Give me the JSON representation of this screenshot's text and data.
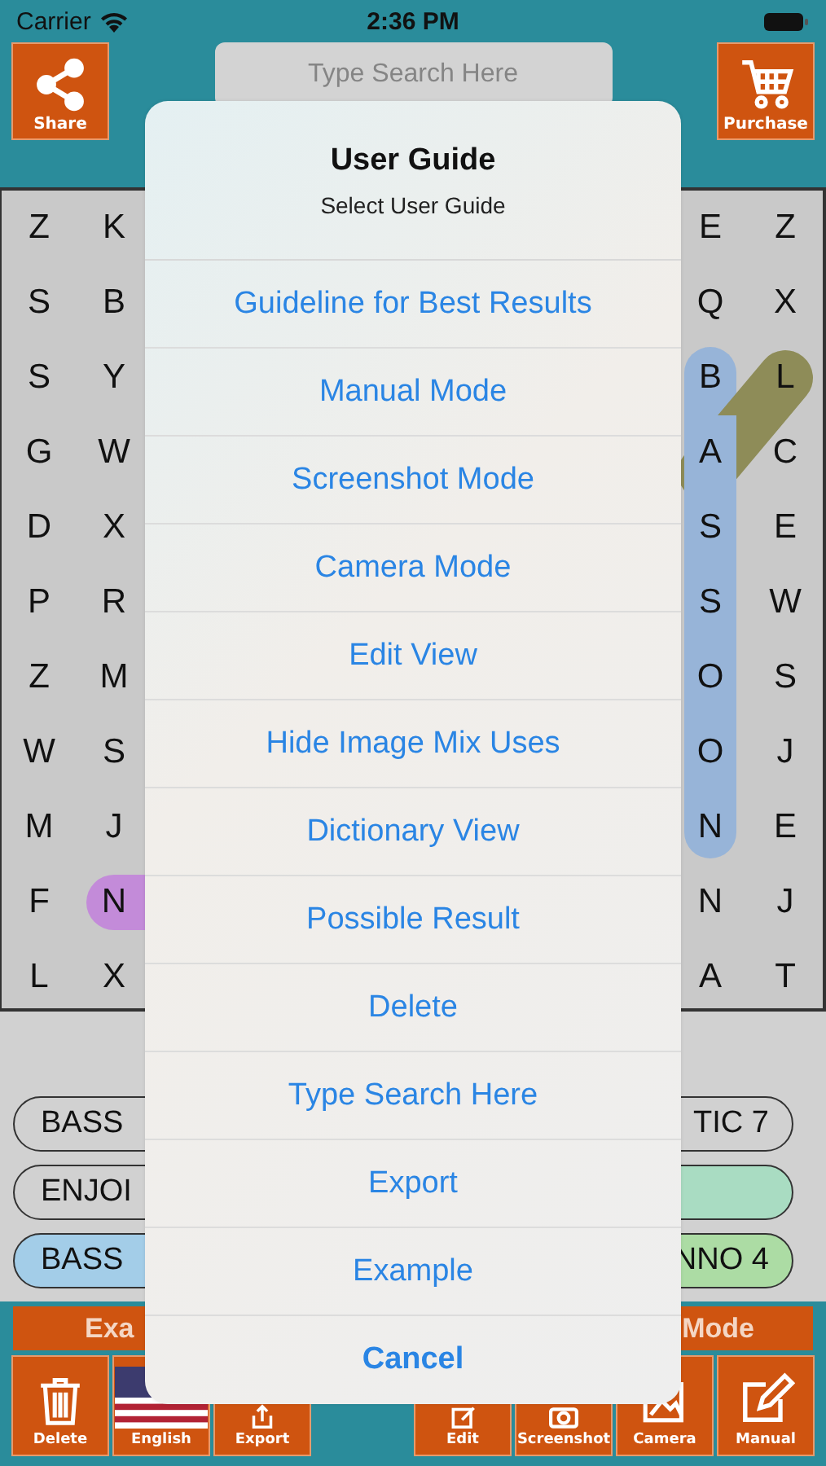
{
  "status_bar": {
    "carrier": "Carrier",
    "time": "2:36 PM"
  },
  "toolbar": {
    "share": {
      "label": "Share",
      "kind": "share"
    },
    "search": {
      "placeholder": "Type Search Here"
    },
    "purchase": {
      "label": "Purchase",
      "kind": "cart"
    }
  },
  "grid": {
    "rows": [
      {
        "left": [
          {
            "letter": "Z"
          },
          {
            "letter": "K"
          }
        ],
        "right": [
          {
            "letter": "E"
          },
          {
            "letter": "Z"
          }
        ]
      },
      {
        "left": [
          {
            "letter": "S"
          },
          {
            "letter": "B"
          }
        ],
        "right": [
          {
            "letter": "Q"
          },
          {
            "letter": "X"
          }
        ]
      },
      {
        "left": [
          {
            "letter": "S"
          },
          {
            "letter": "Y"
          }
        ],
        "right": [
          {
            "letter": "B",
            "mark": {
              "color": "#97b4d8",
              "kind": "vertical"
            }
          },
          {
            "letter": "L",
            "mark": {
              "color": "#8e8c58",
              "kind": "diagonal"
            }
          }
        ]
      },
      {
        "left": [
          {
            "letter": "G"
          },
          {
            "letter": "W"
          }
        ],
        "right": [
          {
            "letter": "A",
            "mark": {
              "color": "#97b4d8",
              "kind": "vertical"
            }
          },
          {
            "letter": "C"
          }
        ]
      },
      {
        "left": [
          {
            "letter": "D"
          },
          {
            "letter": "X"
          }
        ],
        "right": [
          {
            "letter": "S",
            "mark": {
              "color": "#97b4d8",
              "kind": "vertical"
            }
          },
          {
            "letter": "E"
          }
        ]
      },
      {
        "left": [
          {
            "letter": "P"
          },
          {
            "letter": "R"
          }
        ],
        "right": [
          {
            "letter": "S",
            "mark": {
              "color": "#97b4d8",
              "kind": "vertical"
            }
          },
          {
            "letter": "W"
          }
        ]
      },
      {
        "left": [
          {
            "letter": "Z"
          },
          {
            "letter": "M"
          }
        ],
        "right": [
          {
            "letter": "O",
            "mark": {
              "color": "#97b4d8",
              "kind": "vertical"
            }
          },
          {
            "letter": "S"
          }
        ]
      },
      {
        "left": [
          {
            "letter": "W"
          },
          {
            "letter": "S"
          }
        ],
        "right": [
          {
            "letter": "O",
            "mark": {
              "color": "#97b4d8",
              "kind": "vertical"
            }
          },
          {
            "letter": "J"
          }
        ]
      },
      {
        "left": [
          {
            "letter": "M"
          },
          {
            "letter": "J"
          }
        ],
        "right": [
          {
            "letter": "N",
            "mark": {
              "color": "#97b4d8",
              "kind": "vertical"
            }
          },
          {
            "letter": "E"
          }
        ]
      },
      {
        "left": [
          {
            "letter": "F"
          },
          {
            "letter": "N",
            "mark": {
              "color": "#c38bd9",
              "kind": "horizontal"
            }
          }
        ],
        "right": [
          {
            "letter": "N"
          },
          {
            "letter": "J"
          }
        ]
      },
      {
        "left": [
          {
            "letter": "L"
          },
          {
            "letter": "X"
          }
        ],
        "right": [
          {
            "letter": "A"
          },
          {
            "letter": "T"
          }
        ]
      }
    ]
  },
  "word_list": [
    {
      "left": {
        "text": "BASS",
        "color": "#d1d1d1"
      },
      "right": {
        "text": "TIC 7",
        "color": "#d1d1d1"
      }
    },
    {
      "left": {
        "text": "ENJOI",
        "color": "#d1d1d1"
      },
      "right": {
        "color": "#a9dcc2"
      }
    },
    {
      "left": {
        "text": "BASS",
        "color": "#a3cde8"
      },
      "right": {
        "text": "NNO 4",
        "color": "#acdca4"
      }
    }
  ],
  "mode_bar": {
    "left": "Exa",
    "right": "Mode"
  },
  "bottom_buttons": {
    "left": [
      {
        "label": "Delete",
        "kind": "trash"
      },
      {
        "label": "English",
        "kind": "flag"
      },
      {
        "label": "Export",
        "kind": "export"
      }
    ],
    "right": [
      {
        "label": "Edit",
        "kind": "edit"
      },
      {
        "label": "Screenshot",
        "kind": "screenshot"
      },
      {
        "label": "Camera",
        "kind": "camera"
      },
      {
        "label": "Manual",
        "kind": "manual"
      }
    ]
  },
  "sheet": {
    "title": "User Guide",
    "subtitle": "Select User Guide",
    "actions": [
      "Guideline for Best Results",
      "Manual Mode",
      "Screenshot Mode",
      "Camera Mode",
      "Edit View",
      "Hide Image Mix Uses",
      "Dictionary View",
      "Possible Result",
      "Delete",
      "Type Search Here",
      "Export",
      "Example"
    ],
    "cancel": "Cancel"
  }
}
